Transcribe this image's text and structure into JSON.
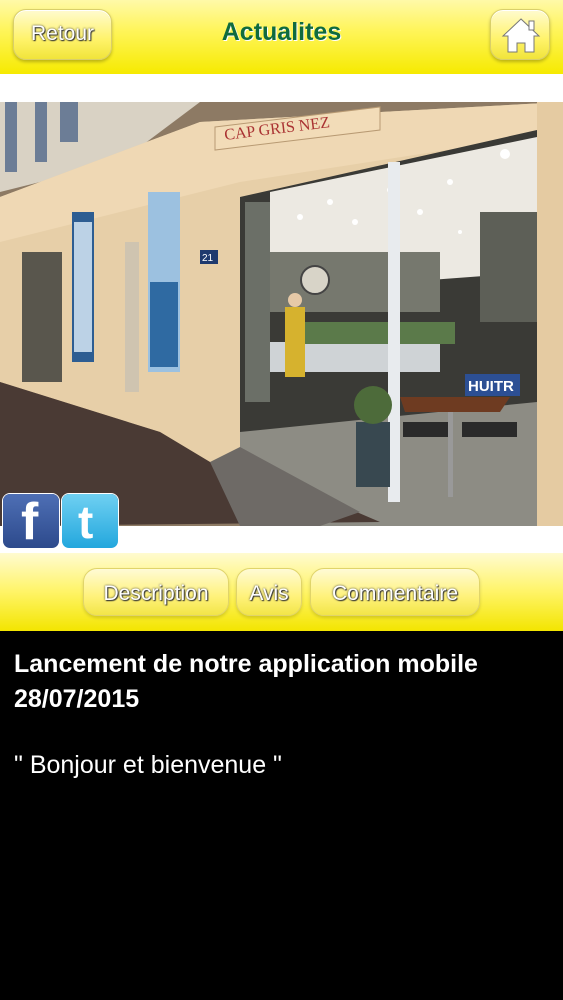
{
  "header": {
    "back_label": "Retour",
    "title": "Actualites",
    "home_icon": "home-icon"
  },
  "photo": {
    "sign_text": "CAP GRIS NEZ",
    "door_number": "21",
    "stand_label": "HUITR"
  },
  "social": [
    {
      "name": "facebook",
      "glyph": "f"
    },
    {
      "name": "twitter",
      "glyph": "t"
    }
  ],
  "tabs": [
    {
      "label": "Description"
    },
    {
      "label": "Avis"
    },
    {
      "label": "Commentaire"
    }
  ],
  "article": {
    "headline": "Lancement de notre application mobile 28/07/2015",
    "body": "\" Bonjour et bienvenue \""
  },
  "colors": {
    "bar_yellow": "#fff55c",
    "title_green": "#0f6b3e",
    "content_bg": "#000000"
  }
}
